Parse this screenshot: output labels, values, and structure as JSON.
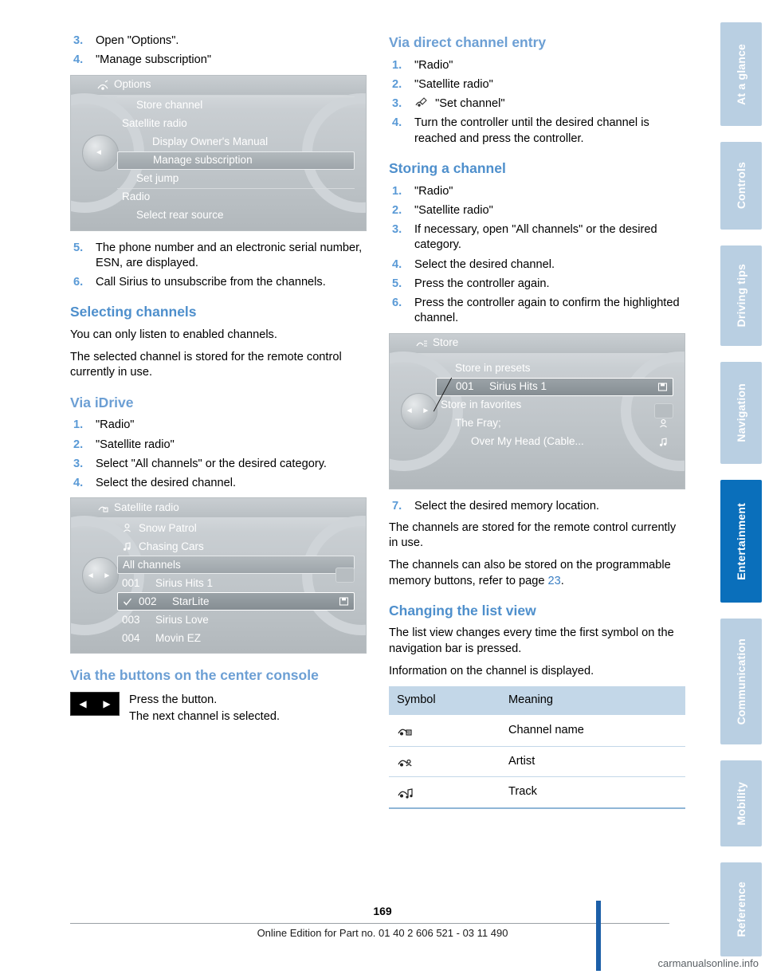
{
  "page": {
    "number": "169",
    "footer": "Online Edition for Part no. 01 40 2 606 521 - 03 11 490",
    "watermark": "carmanualsonline.info"
  },
  "rail": {
    "tabs": [
      {
        "label": "At a glance",
        "active": false
      },
      {
        "label": "Controls",
        "active": false
      },
      {
        "label": "Driving tips",
        "active": false
      },
      {
        "label": "Navigation",
        "active": false
      },
      {
        "label": "Entertainment",
        "active": true
      },
      {
        "label": "Communication",
        "active": false
      },
      {
        "label": "Mobility",
        "active": false
      },
      {
        "label": "Reference",
        "active": false
      }
    ],
    "accent_active": "#0a6fbb",
    "accent_inactive": "#b9cfe2"
  },
  "left": {
    "steps_top": [
      {
        "num": "3.",
        "text": "Open \"Options\"."
      },
      {
        "num": "4.",
        "text": "\"Manage subscription\""
      }
    ],
    "options_panel": {
      "title": "Options",
      "rows": [
        {
          "label": "Store channel",
          "indent": 1,
          "sep": true
        },
        {
          "label": "Satellite radio",
          "indent": 0,
          "sep": false
        },
        {
          "label": "Display Owner's Manual",
          "indent": 2,
          "sep": false
        },
        {
          "label": "Manage subscription",
          "indent": 2,
          "selected": true
        },
        {
          "label": "Set jump",
          "indent": 1,
          "sep": false
        },
        {
          "label": "Radio",
          "indent": 0,
          "sep": true
        },
        {
          "label": "Select rear source",
          "indent": 1,
          "sep": false
        }
      ]
    },
    "steps_mid": [
      {
        "num": "5.",
        "text": "The phone number and an electronic serial number, ESN, are displayed."
      },
      {
        "num": "6.",
        "text": "Call Sirius to unsubscribe from the channels."
      }
    ],
    "heading_selecting": "Selecting channels",
    "para_1": "You can only listen to enabled channels.",
    "para_2": "The selected channel is stored for the remote control currently in use.",
    "heading_idrive": "Via iDrive",
    "steps_idrive": [
      {
        "num": "1.",
        "text": "\"Radio\""
      },
      {
        "num": "2.",
        "text": "\"Satellite radio\""
      },
      {
        "num": "3.",
        "text": "Select \"All channels\" or the desired category."
      },
      {
        "num": "4.",
        "text": "Select the desired channel."
      }
    ],
    "satellite_panel": {
      "title": "Satellite radio",
      "rows": [
        {
          "icon": "artist-icon",
          "label": "Snow Patrol"
        },
        {
          "icon": "track-icon",
          "label": "Chasing Cars"
        },
        {
          "label": "All channels",
          "boxed": true
        },
        {
          "num": "001",
          "label": "Sirius Hits 1"
        },
        {
          "check": true,
          "num": "002",
          "label": "StarLite",
          "selected": true,
          "right_icon": "preset-icon"
        },
        {
          "num": "003",
          "label": "Sirius Love"
        },
        {
          "num": "004",
          "label": "Movin EZ"
        }
      ]
    },
    "heading_buttons": "Via the buttons on the center console",
    "button_text_1": "Press the button.",
    "button_text_2": "The next channel is selected."
  },
  "right": {
    "heading_direct": "Via direct channel entry",
    "steps_direct": [
      {
        "num": "1.",
        "text": "\"Radio\""
      },
      {
        "num": "2.",
        "text": "\"Satellite radio\""
      },
      {
        "num": "3.",
        "text": "\"Set channel\"",
        "icon": "set-channel-icon"
      },
      {
        "num": "4.",
        "text": "Turn the controller until the desired channel is reached and press the controller."
      }
    ],
    "heading_storing": "Storing a channel",
    "steps_storing": [
      {
        "num": "1.",
        "text": "\"Radio\""
      },
      {
        "num": "2.",
        "text": "\"Satellite radio\""
      },
      {
        "num": "3.",
        "text": "If necessary, open \"All channels\" or the desired category."
      },
      {
        "num": "4.",
        "text": "Select the desired channel."
      },
      {
        "num": "5.",
        "text": "Press the controller again."
      },
      {
        "num": "6.",
        "text": "Press the controller again to confirm the highlighted channel."
      }
    ],
    "store_panel": {
      "title": "Store",
      "rows": [
        {
          "label": "Store in presets",
          "indent": 1
        },
        {
          "num": "001",
          "label": "Sirius Hits 1",
          "selected": true,
          "right_icon": "preset-icon"
        },
        {
          "label": "Store in favorites",
          "indent": 0
        },
        {
          "label": "The Fray;",
          "indent": 1,
          "right_icon": "artist-icon"
        },
        {
          "label": "Over My Head (Cable...",
          "indent": 2,
          "right_icon": "track-icon"
        }
      ]
    },
    "step_7": {
      "num": "7.",
      "text": "Select the desired memory location."
    },
    "para_1": "The channels are stored for the remote control currently in use.",
    "para_2_pre": "The channels can also be stored on the programmable memory buttons, refer to page ",
    "para_2_link": "23",
    "para_2_post": ".",
    "heading_listview": "Changing the list view",
    "para_3": "The list view changes every time the first symbol on the navigation bar is pressed.",
    "para_4": "Information on the channel is displayed.",
    "table": {
      "headers": [
        "Symbol",
        "Meaning"
      ],
      "rows": [
        {
          "symbol": "channel-name-icon",
          "meaning": "Channel name"
        },
        {
          "symbol": "artist-icon",
          "meaning": "Artist"
        },
        {
          "symbol": "track-icon",
          "meaning": "Track"
        }
      ]
    }
  }
}
